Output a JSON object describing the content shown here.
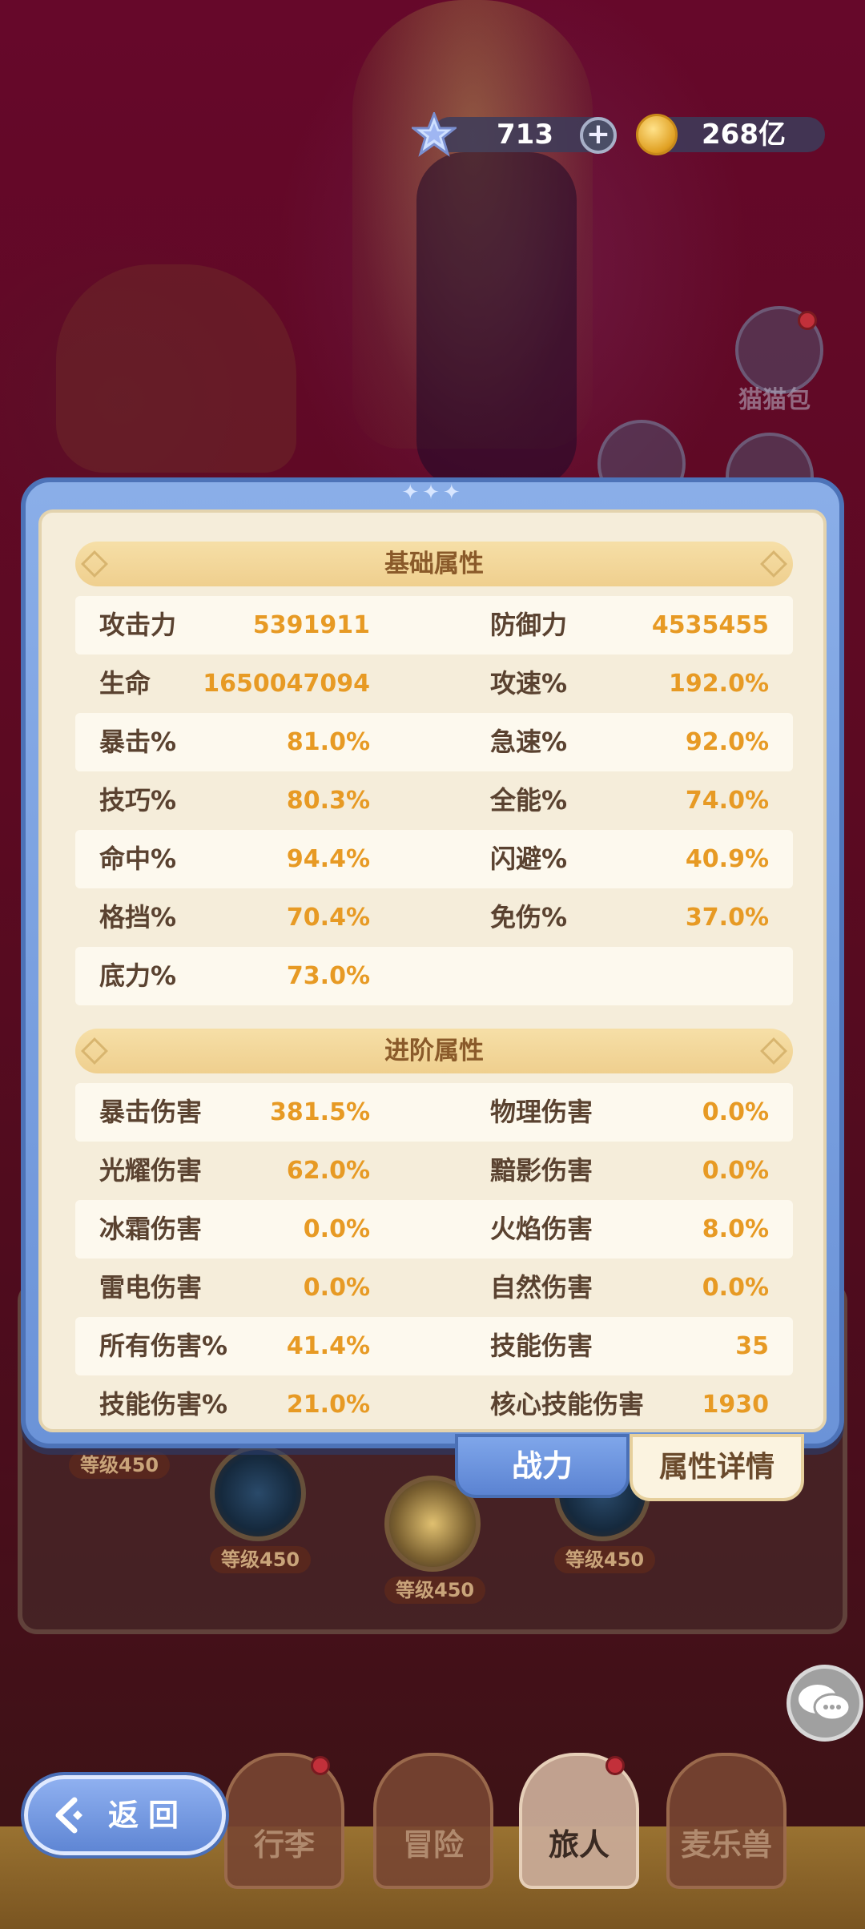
{
  "currency": {
    "gems": "713",
    "gold": "268亿"
  },
  "background": {
    "side_label": "猫猫包",
    "level_badges": [
      "等级450",
      "等级450",
      "等级450",
      "等级450"
    ]
  },
  "panel": {
    "basic_title": "基础属性",
    "advanced_title": "进阶属性",
    "basic_rows": [
      {
        "l1": "攻击力",
        "v1": "5391911",
        "l2": "防御力",
        "v2": "4535455"
      },
      {
        "l1": "生命",
        "v1": "1650047094",
        "l2": "攻速%",
        "v2": "192.0%"
      },
      {
        "l1": "暴击%",
        "v1": "81.0%",
        "l2": "急速%",
        "v2": "92.0%"
      },
      {
        "l1": "技巧%",
        "v1": "80.3%",
        "l2": "全能%",
        "v2": "74.0%"
      },
      {
        "l1": "命中%",
        "v1": "94.4%",
        "l2": "闪避%",
        "v2": "40.9%"
      },
      {
        "l1": "格挡%",
        "v1": "70.4%",
        "l2": "免伤%",
        "v2": "37.0%"
      },
      {
        "l1": "底力%",
        "v1": "73.0%",
        "l2": "",
        "v2": ""
      }
    ],
    "advanced_rows": [
      {
        "l1": "暴击伤害",
        "v1": "381.5%",
        "l2": "物理伤害",
        "v2": "0.0%"
      },
      {
        "l1": "光耀伤害",
        "v1": "62.0%",
        "l2": "黯影伤害",
        "v2": "0.0%"
      },
      {
        "l1": "冰霜伤害",
        "v1": "0.0%",
        "l2": "火焰伤害",
        "v2": "8.0%"
      },
      {
        "l1": "雷电伤害",
        "v1": "0.0%",
        "l2": "自然伤害",
        "v2": "0.0%"
      },
      {
        "l1": "所有伤害%",
        "v1": "41.4%",
        "l2": "技能伤害",
        "v2": "35"
      },
      {
        "l1": "技能伤害%",
        "v1": "21.0%",
        "l2": "核心技能伤害",
        "v2": "1930"
      }
    ]
  },
  "tabs": {
    "power": "战力",
    "detail": "属性详情"
  },
  "nav": {
    "back": "返回",
    "items": [
      "行李",
      "冒险",
      "旅人",
      "麦乐兽"
    ]
  },
  "colors": {
    "value_orange": "#e79a24",
    "label_brown": "#5a4230",
    "frame_blue": "#6b93d8"
  }
}
